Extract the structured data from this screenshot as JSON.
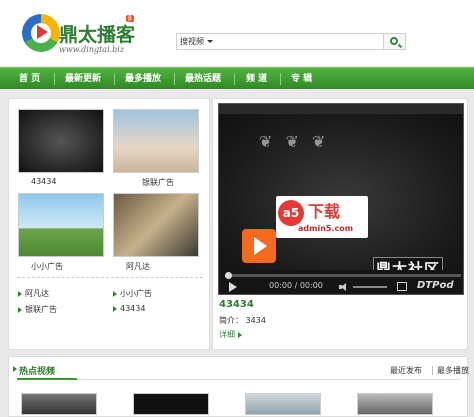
{
  "brand": {
    "title": "鼎太播客",
    "badge": "β",
    "url": "www.dingtai.biz"
  },
  "search": {
    "select_value": "搜视频",
    "placeholder": ""
  },
  "nav": {
    "items": [
      "首 页",
      "最新更新",
      "最多播放",
      "最热话题",
      "频 道",
      "专 辑"
    ]
  },
  "left": {
    "thumbs": [
      {
        "label": "43434"
      },
      {
        "label": "银联广告"
      },
      {
        "label": "小小广告"
      },
      {
        "label": "阿凡达"
      }
    ],
    "links": [
      "阿凡达",
      "小小广告",
      "银联广告",
      "43434"
    ]
  },
  "player": {
    "overlay_text": "鼎太社区",
    "watermark_download": "下载",
    "watermark_logo": "a5",
    "watermark_site": "admin5.com",
    "time": "00:00 / 00:00",
    "brand": "DTPod"
  },
  "info": {
    "title": "43434",
    "intro_label": "简介：",
    "intro_value": "3434",
    "more": "详细"
  },
  "hot": {
    "title": "热点视频",
    "tab_recent": "最近发布",
    "tab_most": "最多播放"
  },
  "colors": {
    "nav_green": "#3a9b2a",
    "text_green": "#2e7d32",
    "play_orange": "#f36b1f"
  }
}
